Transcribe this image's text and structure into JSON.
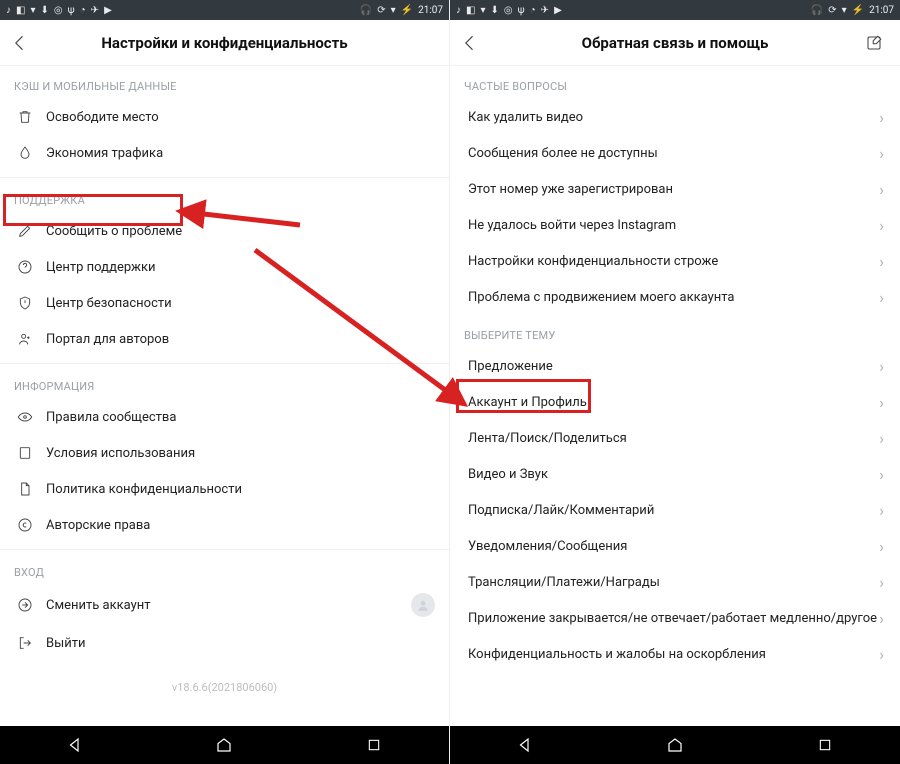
{
  "status": {
    "time": "21:07"
  },
  "left": {
    "title": "Настройки и конфиденциальность",
    "sections": [
      {
        "header": "КЭШ И МОБИЛЬНЫЕ ДАННЫЕ",
        "items": [
          {
            "label": "Освободите место"
          },
          {
            "label": "Экономия трафика"
          }
        ]
      },
      {
        "header": "ПОДДЕРЖКА",
        "items": [
          {
            "label": "Сообщить о проблеме"
          },
          {
            "label": "Центр поддержки"
          },
          {
            "label": "Центр безопасности"
          },
          {
            "label": "Портал для авторов"
          }
        ]
      },
      {
        "header": "ИНФОРМАЦИЯ",
        "items": [
          {
            "label": "Правила сообщества"
          },
          {
            "label": "Условия использования"
          },
          {
            "label": "Политика конфиденциальности"
          },
          {
            "label": "Авторские права"
          }
        ]
      },
      {
        "header": "ВХОД",
        "items": [
          {
            "label": "Сменить аккаунт"
          },
          {
            "label": "Выйти"
          }
        ]
      }
    ],
    "version": "v18.6.6(2021806060)"
  },
  "right": {
    "title": "Обратная связь и помощь",
    "sections": [
      {
        "header": "ЧАСТЫЕ ВОПРОСЫ",
        "items": [
          {
            "label": "Как удалить видео"
          },
          {
            "label": "Сообщения более не доступны"
          },
          {
            "label": "Этот номер уже зарегистрирован"
          },
          {
            "label": "Не удалось войти через Instagram"
          },
          {
            "label": "Настройки конфиденциальности строже"
          },
          {
            "label": "Проблема с продвижением моего аккаунта"
          }
        ]
      },
      {
        "header": "ВЫБЕРИТЕ ТЕМУ",
        "items": [
          {
            "label": "Предложение"
          },
          {
            "label": "Аккаунт и Профиль"
          },
          {
            "label": "Лента/Поиск/Поделиться"
          },
          {
            "label": "Видео и Звук"
          },
          {
            "label": "Подписка/Лайк/Комментарий"
          },
          {
            "label": "Уведомления/Сообщения"
          },
          {
            "label": "Трансляции/Платежи/Награды"
          },
          {
            "label": "Приложение закрывается/не отвечает/работает медленно/другое"
          },
          {
            "label": "Конфиденциальность и жалобы на оскорбления"
          }
        ]
      }
    ]
  }
}
